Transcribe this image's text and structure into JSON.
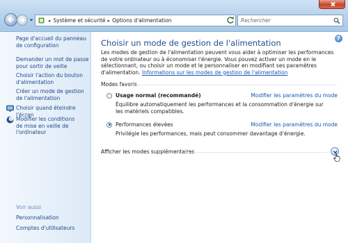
{
  "address": {
    "crumbs": [
      "Système et sécurité",
      "Options d'alimentation"
    ],
    "separator": "▸"
  },
  "search": {
    "placeholder": "Rechercher"
  },
  "sidebar": {
    "items": [
      {
        "label": "Page d'accueil du panneau de configuration"
      },
      {
        "label": "Demander un mot de passe pour sortir de veille"
      },
      {
        "label": "Choisir l'action du bouton d'alimentation"
      },
      {
        "label": "Créer un mode de gestion de l'alimentation"
      },
      {
        "label": "Choisir quand éteindre l'écran",
        "icon": "monitor-icon"
      },
      {
        "label": "Modifier les conditions de mise en veille de l'ordinateur",
        "icon": "moon-icon"
      }
    ],
    "see_also": {
      "heading": "Voir aussi",
      "links": [
        "Personnalisation",
        "Comptes d'utilisateurs"
      ]
    }
  },
  "main": {
    "title": "Choisir un mode de gestion de l'alimentation",
    "intro": "Les modes de gestion de l'alimentation peuvent vous aider à optimiser les performances de votre ordinateur ou à économiser l'énergie. Vous pouvez activer un mode en le sélectionnant, ou choisir un mode et le personnaliser en modifiant ses paramètres d'alimentation.",
    "intro_link": "Informations sur les modes de gestion de l'alimentation",
    "section_label": "Modes favoris",
    "plans": [
      {
        "name": "Usage normal (recommandé)",
        "selected": false,
        "modify": "Modifier les paramètres du mode",
        "description": "Équilibre automatiquement les performances et la consommation d'énergie sur les matériels compatibles."
      },
      {
        "name": "Performances élevées",
        "selected": true,
        "modify": "Modifier les paramètres du mode",
        "description": "Privilégie les performances, mais peut consommer davantage d'énergie."
      }
    ],
    "more_label": "Afficher les modes supplémentaires",
    "help": "?"
  },
  "colors": {
    "link": "#1a55b3",
    "title": "#1f4e8c",
    "sidebar_link": "#1d4a8a",
    "see_also": "#6d8fb5"
  }
}
